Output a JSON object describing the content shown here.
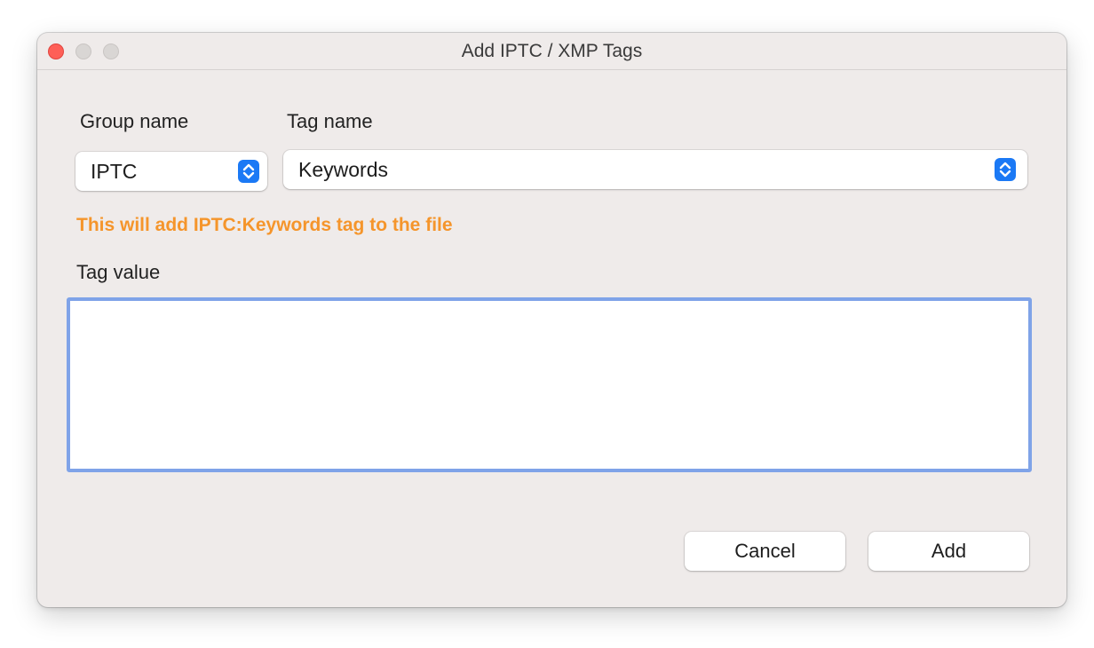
{
  "window": {
    "title": "Add IPTC / XMP Tags"
  },
  "form": {
    "group_label": "Group name",
    "tag_label": "Tag name",
    "group_value": "IPTC",
    "tag_value_select": "Keywords",
    "hint": "This will add IPTC:Keywords tag to the file",
    "value_label": "Tag value",
    "value_text": ""
  },
  "buttons": {
    "cancel": "Cancel",
    "add": "Add"
  },
  "colors": {
    "hint": "#f5952b",
    "accent": "#1b79f5",
    "focus_ring": "#7fa3e8",
    "close": "#fe5f57"
  },
  "icons": {
    "stepper": "chevron-up-down-icon"
  }
}
